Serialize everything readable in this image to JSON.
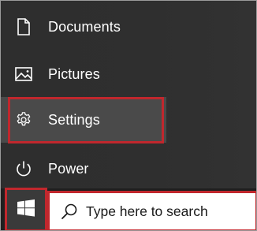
{
  "start_menu": {
    "items": [
      {
        "label": "Documents",
        "icon": "document-icon"
      },
      {
        "label": "Pictures",
        "icon": "pictures-icon"
      },
      {
        "label": "Settings",
        "icon": "gear-icon"
      },
      {
        "label": "Power",
        "icon": "power-icon"
      }
    ]
  },
  "taskbar": {
    "start_icon": "windows-logo-icon",
    "search": {
      "placeholder": "Type here to search",
      "icon": "search-icon"
    }
  },
  "colors": {
    "menu_background": "#2f2f2f",
    "selected_item_background": "#4a4a4a",
    "taskbar_background": "#1f1f1f",
    "highlight_border": "#c1272d",
    "text": "#ffffff"
  }
}
